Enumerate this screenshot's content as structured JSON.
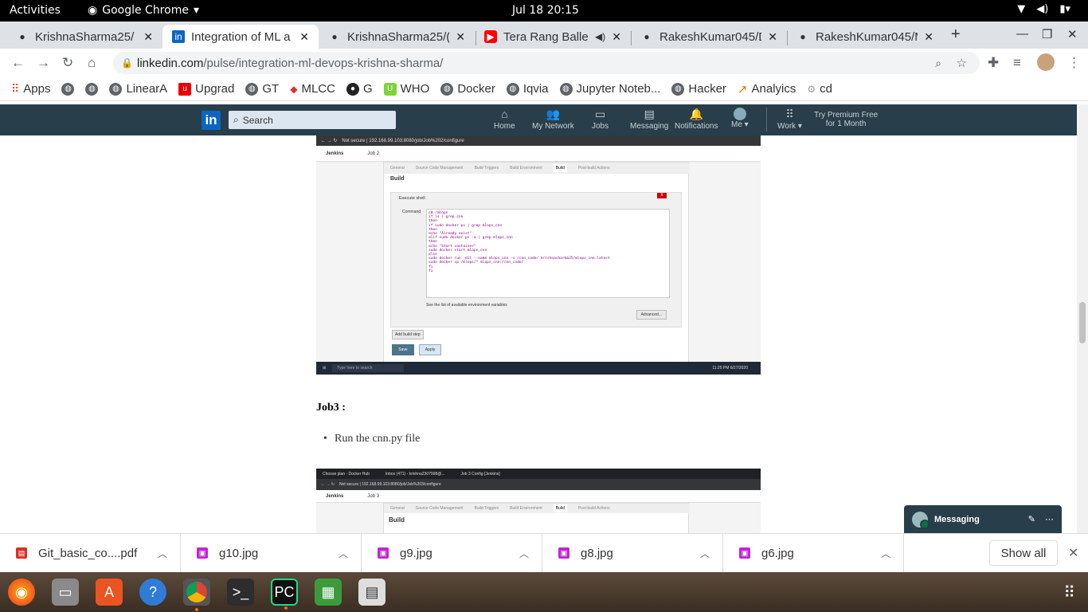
{
  "gnome": {
    "activities": "Activities",
    "app": "Google Chrome",
    "clock": "Jul 18  20:15"
  },
  "tabs": [
    {
      "title": "KrishnaSharma25/",
      "icon": "github-icon"
    },
    {
      "title": "Integration of ML a",
      "icon": "linkedin-icon",
      "active": true
    },
    {
      "title": "KrishnaSharma25/(",
      "icon": "github-icon"
    },
    {
      "title": "Tera Rang Balle",
      "icon": "youtube-icon"
    },
    {
      "title": "RakeshKumar045/D",
      "icon": "github-icon"
    },
    {
      "title": "RakeshKumar045/M",
      "icon": "github-icon"
    }
  ],
  "url": {
    "host": "linkedin.com",
    "path": "/pulse/integration-ml-devops-krishna-sharma/"
  },
  "bookmarks": [
    "Apps",
    "",
    "",
    "LinearA",
    "Upgrad",
    "GT",
    "MLCC",
    "G",
    "WHO",
    "Docker",
    "Iqvia",
    "Jupyter Noteb...",
    "Hacker",
    "Analyics",
    "cd"
  ],
  "linkedin": {
    "search_placeholder": "Search",
    "nav": [
      "Home",
      "My Network",
      "Jobs",
      "Messaging",
      "Notifications",
      "Me"
    ],
    "work": "Work",
    "premium_line1": "Try Premium Free",
    "premium_line2": "for 1 Month"
  },
  "shot1": {
    "url": "Not secure | 192.168.99.103:8080/job/Job%202/configure",
    "breadcrumb": [
      "Jenkins",
      "Job 2"
    ],
    "tabs": [
      "General",
      "Source Code Management",
      "Build Triggers",
      "Build Environment",
      "Build",
      "Post-build Actions"
    ],
    "heading": "Build",
    "step": "Execute shell",
    "command_label": "Command",
    "code": "cd /mlops\nif ls | grep cnn\nthen\nif sudo docker ps | grep mlops_cnn\nthen\necho \"Already exist\"\nelif sudo docker ps -a | grep mlops_cnn\nthen\necho \"Start container\"\nsudo docker start mlops_cnn\nelse\nsudo docker run -dit --name mlops_cnn -v /cnn_code/ krishnasharma25/mlops_cnn:latest\nsudo docker cp /mlops/* mlops_cnn:/cnn_code/\nfi\nfi",
    "env_link": "See the list of available environment variables",
    "advanced": "Advanced...",
    "add_build_step": "Add build step",
    "save": "Save",
    "apply": "Apply",
    "taskbar_search": "Type here to search",
    "taskbar_clock": "11:25 PM 6/27/2020"
  },
  "article": {
    "job3_heading": "Job3 :",
    "bullet": "Run the cnn.py file"
  },
  "shot2": {
    "tabs": [
      "Choose plan - Docker Hub",
      "Inbox (471) - krishna2307998@...",
      "Job 3 Config [Jenkins]"
    ],
    "url": "Not secure | 192.168.99.103:8080/job/Job%203/configure",
    "breadcrumb": [
      "Jenkins",
      "Job 3"
    ],
    "tabsx": [
      "General",
      "Source Code Management",
      "Build Triggers",
      "Build Environment",
      "Build",
      "Post-build Actions"
    ],
    "heading": "Build"
  },
  "messaging": {
    "label": "Messaging"
  },
  "downloads": [
    {
      "name": "Git_basic_co....pdf",
      "type": "pdf"
    },
    {
      "name": "g10.jpg",
      "type": "image"
    },
    {
      "name": "g9.jpg",
      "type": "image"
    },
    {
      "name": "g8.jpg",
      "type": "image"
    },
    {
      "name": "g6.jpg",
      "type": "image"
    }
  ],
  "show_all": "Show all",
  "colors": {
    "linkedin_nav": "#283e4a",
    "linkedin_blue": "#0a66c2",
    "chrome_tabbar": "#dee1e6"
  }
}
